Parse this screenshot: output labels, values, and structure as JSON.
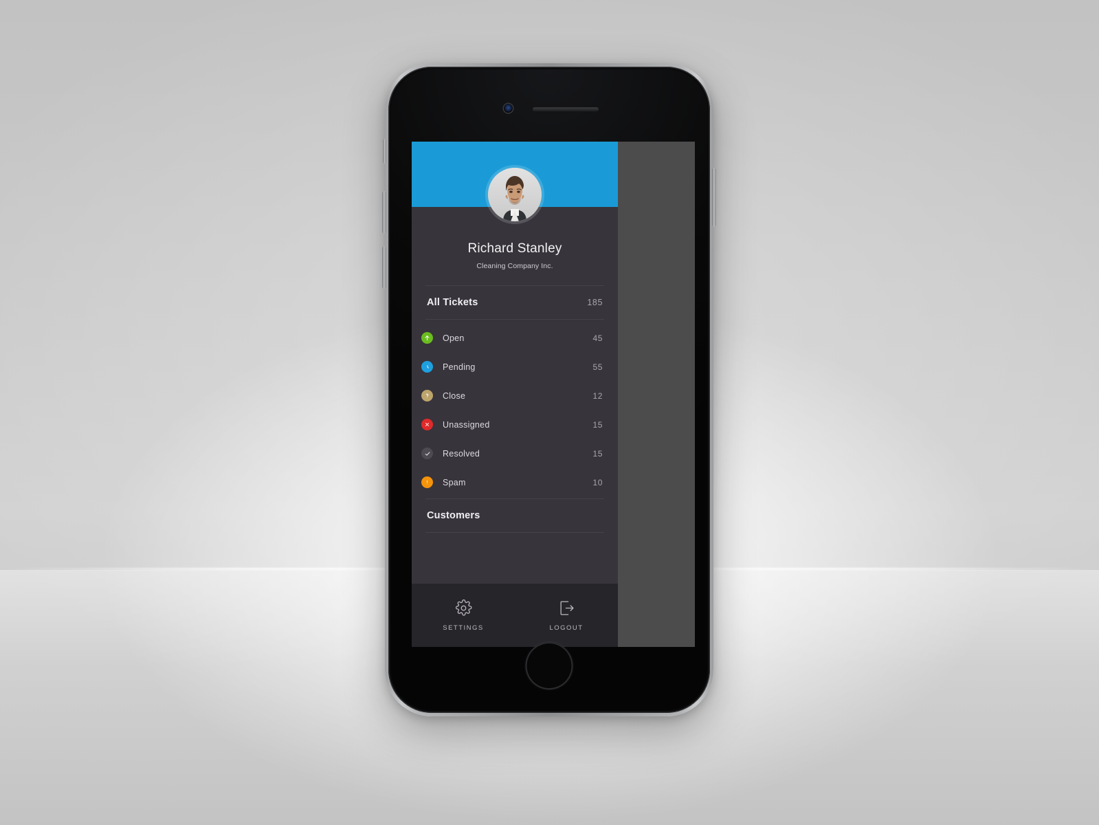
{
  "app": {
    "accent_color": "#1a9bd7",
    "drawer_color": "#37343c",
    "footer_color": "#26252a",
    "scrim_color": "#4c4c4c"
  },
  "profile": {
    "name": "Richard Stanley",
    "company": "Cleaning Company Inc.",
    "avatar_icon": "user-photo-avatar"
  },
  "tickets_section": {
    "title": "All Tickets",
    "total": "185",
    "items": [
      {
        "label": "Open",
        "count": "45",
        "icon": "arrow-up-circle-icon",
        "color": "#6bbd1f"
      },
      {
        "label": "Pending",
        "count": "55",
        "icon": "clock-circle-icon",
        "color": "#1e9fe0"
      },
      {
        "label": "Close",
        "count": "12",
        "icon": "question-circle-icon",
        "color": "#bda46c"
      },
      {
        "label": "Unassigned",
        "count": "15",
        "icon": "x-circle-icon",
        "color": "#e02a2a"
      },
      {
        "label": "Resolved",
        "count": "15",
        "icon": "check-circle-icon",
        "color": "#4d4a52"
      },
      {
        "label": "Spam",
        "count": "10",
        "icon": "exclamation-circle-icon",
        "color": "#f5930b"
      }
    ]
  },
  "customers_section": {
    "title": "Customers"
  },
  "footer": {
    "settings_label": "SETTINGS",
    "settings_icon": "gear-icon",
    "logout_label": "LOGOUT",
    "logout_icon": "logout-arrow-icon"
  }
}
